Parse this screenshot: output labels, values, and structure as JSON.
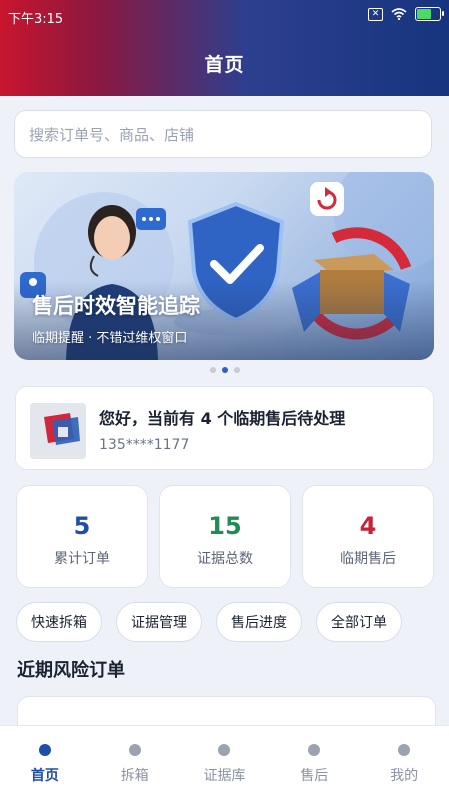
{
  "status_bar": {
    "time": "下午3:15",
    "sim_icon": "close-box-icon",
    "wifi_icon": "wifi-icon",
    "battery_icon": "battery-charging-icon"
  },
  "header": {
    "title": "首页"
  },
  "search": {
    "placeholder": "搜索订单号、商品、店铺"
  },
  "banner": {
    "title": "售后时效智能追踪",
    "subtitle": "临期提醒 · 不错过维权窗口",
    "active_slide": 2,
    "slide_count": 3
  },
  "user": {
    "greeting": "您好，当前有 4 个临期售后待处理",
    "phone": "135****1177"
  },
  "stats": [
    {
      "value": "5",
      "label": "累计订单",
      "color": "#1e4fa8"
    },
    {
      "value": "15",
      "label": "证据总数",
      "color": "#1e8c54"
    },
    {
      "value": "4",
      "label": "临期售后",
      "color": "#c8223a"
    }
  ],
  "shortcuts": [
    "快速拆箱",
    "证据管理",
    "售后进度",
    "全部订单"
  ],
  "section": {
    "title": "近期风险订单"
  },
  "tabs": [
    {
      "label": "首页",
      "active": true
    },
    {
      "label": "拆箱",
      "active": false
    },
    {
      "label": "证据库",
      "active": false
    },
    {
      "label": "售后",
      "active": false
    },
    {
      "label": "我的",
      "active": false
    }
  ],
  "colors": {
    "accent": "#1e4fa8",
    "header_left": "#c8162f",
    "header_right": "#16357e"
  }
}
